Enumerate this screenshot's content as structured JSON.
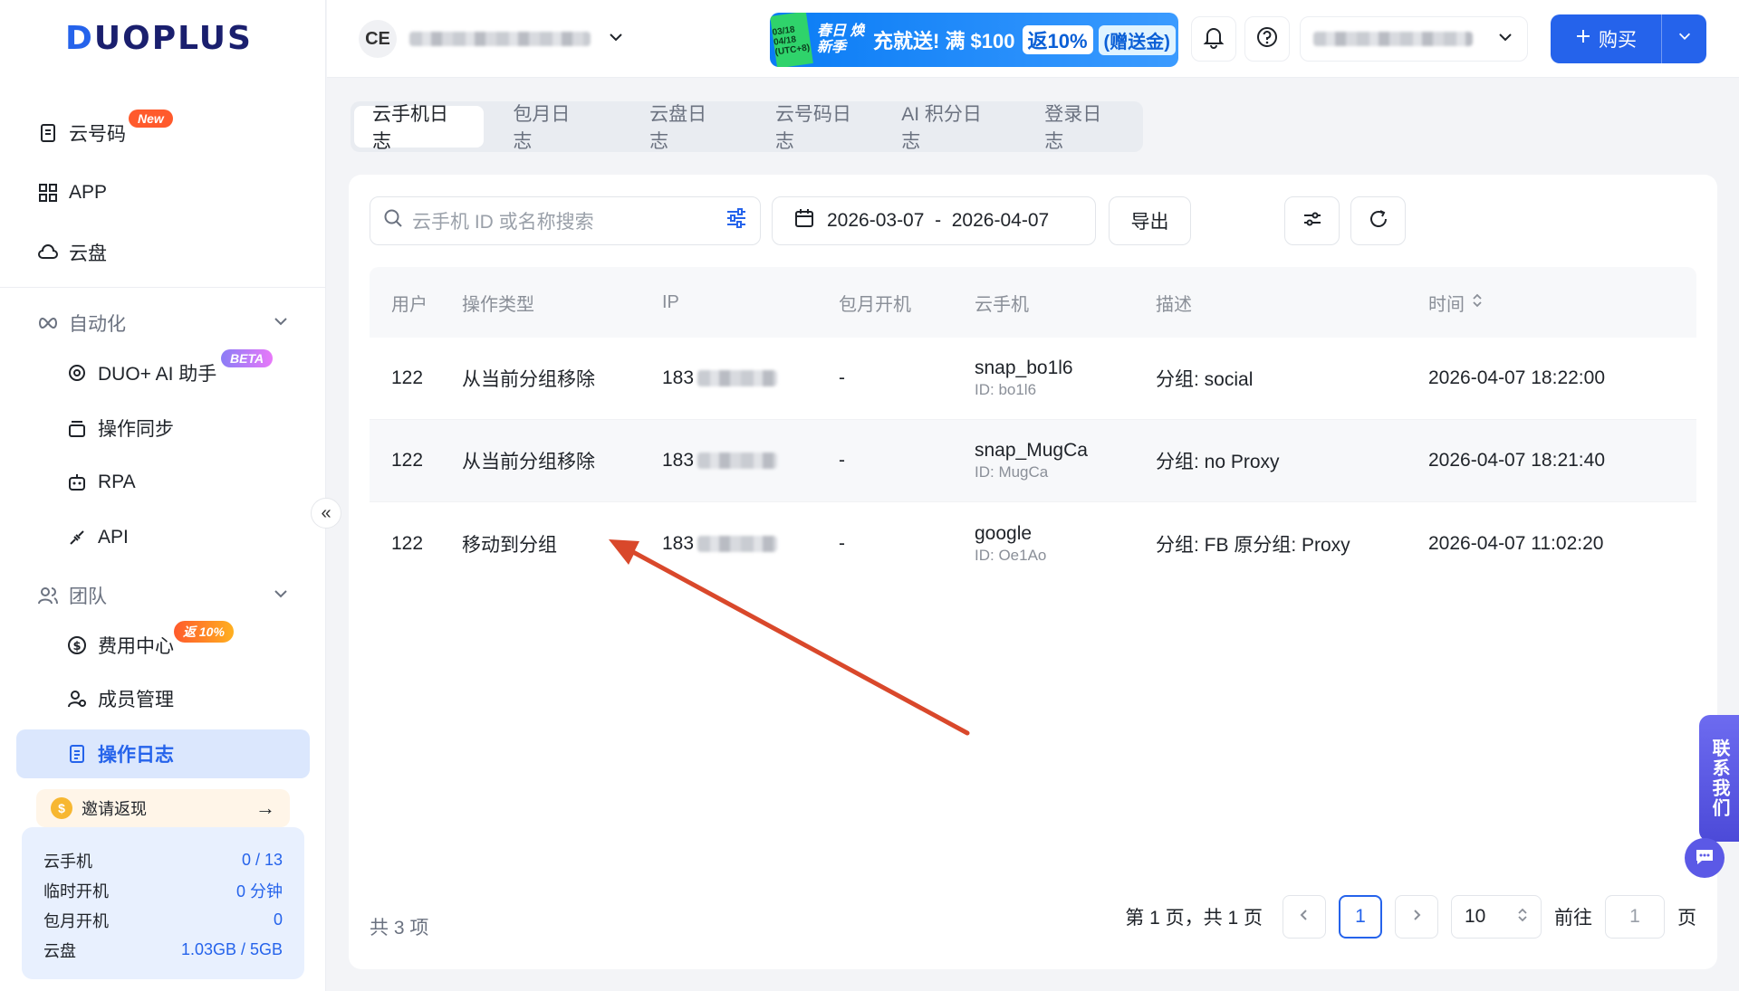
{
  "brand": {
    "logo": "DUOPLUS"
  },
  "sidebar": {
    "items": [
      {
        "label": "云号码",
        "badge": "New",
        "icon": "sim-card-icon"
      },
      {
        "label": "APP",
        "icon": "grid-icon"
      },
      {
        "label": "云盘",
        "icon": "cloud-icon"
      }
    ],
    "automation": {
      "label": "自动化",
      "icon": "infinity-icon",
      "items": [
        {
          "label": "DUO+ AI 助手",
          "badge": "BETA",
          "icon": "ai-icon"
        },
        {
          "label": "操作同步",
          "icon": "sync-icon"
        },
        {
          "label": "RPA",
          "icon": "robot-icon"
        },
        {
          "label": "API",
          "icon": "plug-icon"
        }
      ]
    },
    "team": {
      "label": "团队",
      "icon": "users-icon",
      "items": [
        {
          "label": "费用中心",
          "badge": "返 10%",
          "icon": "dollar-icon"
        },
        {
          "label": "成员管理",
          "icon": "member-icon"
        },
        {
          "label": "操作日志",
          "icon": "log-icon",
          "active": true
        }
      ]
    },
    "invite": {
      "label": "邀请返现"
    },
    "usage": [
      {
        "label": "云手机",
        "value": "0 / 13"
      },
      {
        "label": "临时开机",
        "value": "0 分钟"
      },
      {
        "label": "包月开机",
        "value": "0"
      },
      {
        "label": "云盘",
        "value": "1.03GB / 5GB"
      }
    ]
  },
  "header": {
    "team_initials": "CE",
    "promo": {
      "date": "03/18 04/18 (UTC+8)",
      "line1": "春日 焕新季",
      "line2": "充就送! 满 $100",
      "line3": "返10%",
      "line4": "(赠送金)"
    },
    "buy_label": "购买"
  },
  "tabs": [
    {
      "label": "云手机日志",
      "active": true
    },
    {
      "label": "包月日志"
    },
    {
      "label": "云盘日志"
    },
    {
      "label": "云号码日志"
    },
    {
      "label": "AI 积分日志"
    },
    {
      "label": "登录日志"
    }
  ],
  "toolbar": {
    "search_placeholder": "云手机 ID 或名称搜索",
    "date_range": "2026-03-07  -  2026-04-07",
    "export_label": "导出"
  },
  "table": {
    "columns": [
      "用户",
      "操作类型",
      "IP",
      "包月开机",
      "云手机",
      "描述",
      "时间"
    ],
    "rows": [
      {
        "user": "122",
        "op": "从当前分组移除",
        "ip": "183",
        "monthly": "-",
        "phone_name": "snap_bo1l6",
        "phone_id": "ID: bo1l6",
        "desc": "分组: social",
        "time": "2026-04-07 18:22:00"
      },
      {
        "user": "122",
        "op": "从当前分组移除",
        "ip": "183",
        "monthly": "-",
        "phone_name": "snap_MugCa",
        "phone_id": "ID: MugCa",
        "desc": "分组: no Proxy",
        "time": "2026-04-07 18:21:40"
      },
      {
        "user": "122",
        "op": "移动到分组",
        "ip": "183",
        "monthly": "-",
        "phone_name": "google",
        "phone_id": "ID: Oe1Ao",
        "desc": "分组: FB 原分组: Proxy",
        "time": "2026-04-07 11:02:20"
      }
    ]
  },
  "pagination": {
    "total": "共 3 项",
    "page_info": "第 1 页，共 1 页",
    "current": "1",
    "page_size": "10",
    "goto_label": "前往",
    "goto_value": "1",
    "page_suffix": "页"
  },
  "contact": {
    "label": "联系我们"
  },
  "colors": {
    "accent": "#2563eb",
    "annotation_arrow": "#d9482b"
  }
}
